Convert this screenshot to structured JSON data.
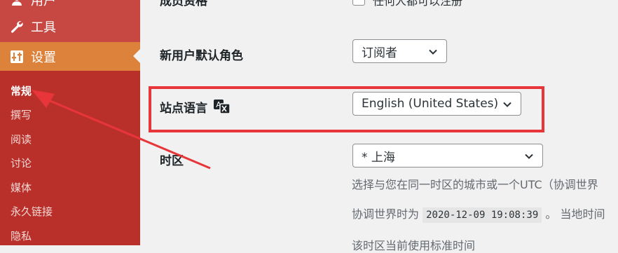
{
  "sidebar": {
    "items": [
      {
        "label": "用户",
        "icon": "user-icon"
      },
      {
        "label": "工具",
        "icon": "wrench-icon"
      },
      {
        "label": "设置",
        "icon": "settings-sliders-icon",
        "active": true
      }
    ],
    "submenu": [
      "常规",
      "撰写",
      "阅读",
      "讨论",
      "媒体",
      "永久链接",
      "隐私"
    ],
    "current_submenu": "常规",
    "colors": {
      "bg": "#b9302a",
      "active": "#dd823b"
    }
  },
  "settings": {
    "membership": {
      "label": "成员资格",
      "checkbox_label": "任何人都可以注册"
    },
    "default_role": {
      "label": "新用户默认角色",
      "value": "订阅者"
    },
    "site_language": {
      "label": "站点语言",
      "icon": "translation-icon",
      "value": "English (United States)"
    },
    "timezone": {
      "label": "时区",
      "value": "* 上海",
      "desc": "选择与您在同一时区的城市或一个UTC（协调世界",
      "utc_prefix": "协调世界时为",
      "utc_time": "2020-12-09 19:08:39",
      "local_suffix": "。 当地时间",
      "note": "该时区当前使用标准时间"
    }
  },
  "annotation": {
    "color": "#e8353a"
  }
}
